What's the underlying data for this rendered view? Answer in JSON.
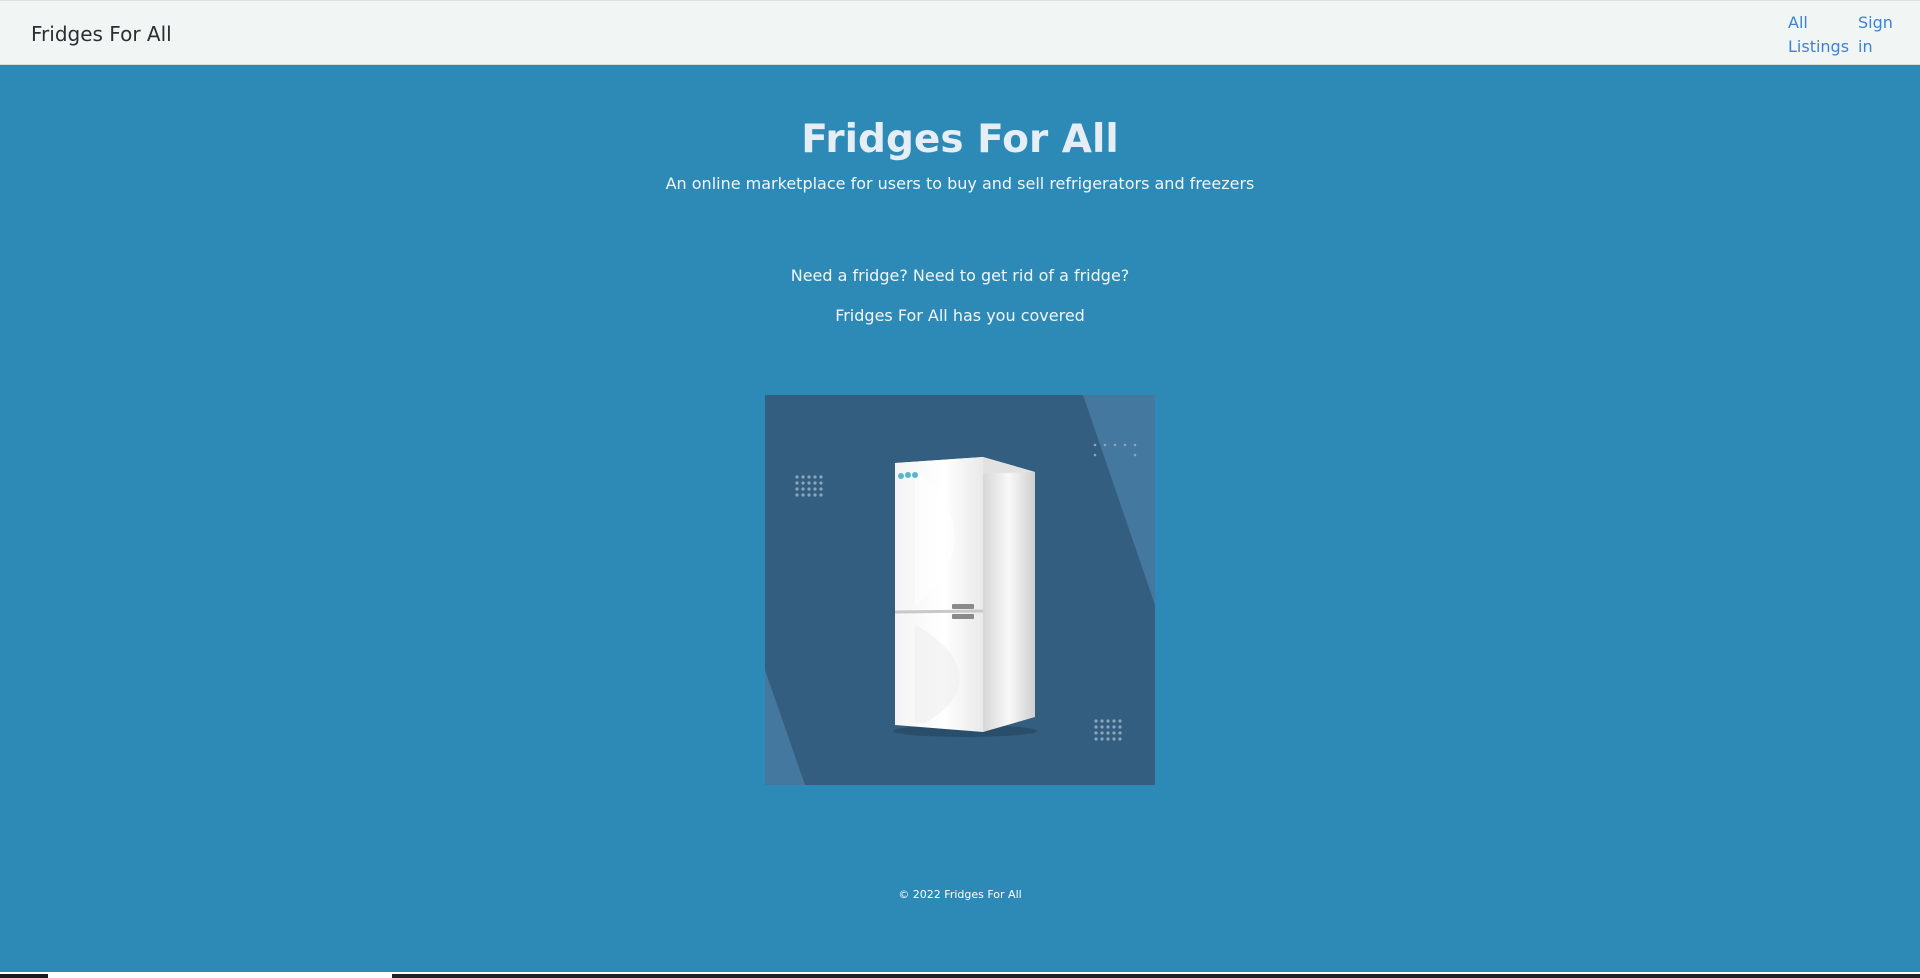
{
  "navbar": {
    "brand": "Fridges For All",
    "links": [
      {
        "label": "All Listings"
      },
      {
        "label": "Sign in"
      }
    ]
  },
  "hero": {
    "title": "Fridges For All",
    "subtitle": "An online marketplace for users to buy and sell refrigerators and freezers"
  },
  "lead": {
    "line1": "Need a fridge? Need to get rid of a fridge?",
    "line2": "Fridges For All has you covered"
  },
  "promo_image": {
    "icon": "refrigerator-illustration"
  },
  "footer": {
    "copyright": "© 2022 Fridges For All"
  },
  "colors": {
    "page_background": "#2d8ab7",
    "navbar_background": "#f1f5f4",
    "link": "#3b83d6",
    "image_background": "#335e80"
  }
}
